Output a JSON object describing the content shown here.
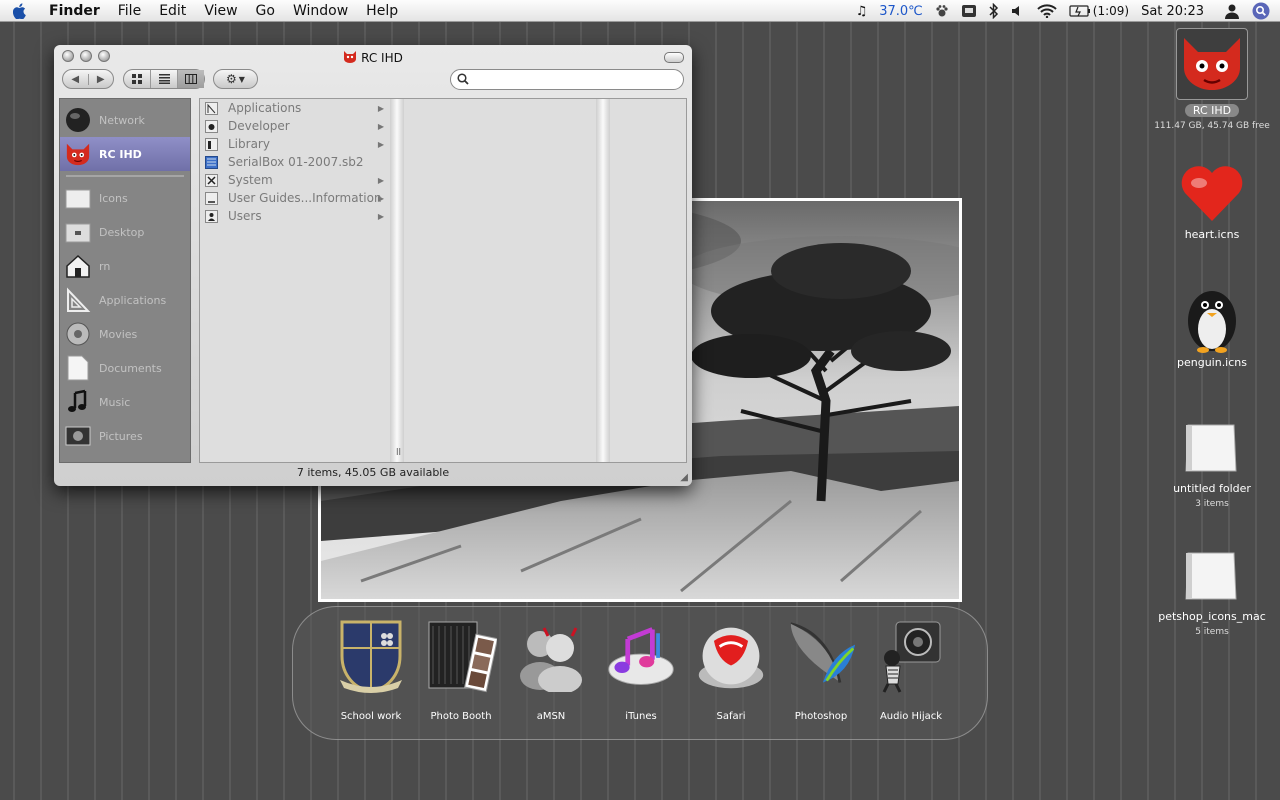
{
  "menubar": {
    "apple_icon": "apple-icon",
    "items": [
      "Finder",
      "File",
      "Edit",
      "View",
      "Go",
      "Window",
      "Help"
    ],
    "temperature": "37.0℃",
    "battery_time": "(1:09)",
    "clock": "Sat 20:23"
  },
  "window": {
    "title": "RC IHD",
    "search_placeholder": "",
    "sidebar": [
      {
        "label": "Network",
        "icon": "network-icon"
      },
      {
        "label": "RC IHD",
        "icon": "devil-cat-icon",
        "selected": true
      },
      {
        "label": "Icons",
        "icon": "folder-icon"
      },
      {
        "label": "Desktop",
        "icon": "desktop-icon"
      },
      {
        "label": "rn",
        "icon": "home-icon"
      },
      {
        "label": "Applications",
        "icon": "applications-icon"
      },
      {
        "label": "Movies",
        "icon": "movies-icon"
      },
      {
        "label": "Documents",
        "icon": "documents-icon"
      },
      {
        "label": "Music",
        "icon": "music-icon"
      },
      {
        "label": "Pictures",
        "icon": "pictures-icon"
      }
    ],
    "files": [
      {
        "name": "Applications",
        "folder": true
      },
      {
        "name": "Developer",
        "folder": true
      },
      {
        "name": "Library",
        "folder": true
      },
      {
        "name": "SerialBox 01-2007.sb2",
        "folder": false
      },
      {
        "name": "System",
        "folder": true
      },
      {
        "name": "User Guides...Information",
        "folder": true
      },
      {
        "name": "Users",
        "folder": true
      }
    ],
    "status": "7 items, 45.05 GB available"
  },
  "dock": [
    {
      "label": "School work",
      "icon": "school-crest-icon"
    },
    {
      "label": "Photo Booth",
      "icon": "photo-booth-icon"
    },
    {
      "label": "aMSN",
      "icon": "amsn-icon"
    },
    {
      "label": "iTunes",
      "icon": "itunes-icon"
    },
    {
      "label": "Safari",
      "icon": "safari-icon"
    },
    {
      "label": "Photoshop",
      "icon": "photoshop-icon"
    },
    {
      "label": "Audio Hijack",
      "icon": "audio-hijack-icon"
    }
  ],
  "desktop": {
    "drive": {
      "label": "RC IHD",
      "info": "111.47 GB, 45.74 GB free"
    },
    "heart": {
      "label": "heart.icns"
    },
    "penguin": {
      "label": "penguin.icns"
    },
    "folder1": {
      "label": "untitled folder",
      "info": "3 items"
    },
    "folder2": {
      "label": "petshop_icons_mac",
      "info": "5 items"
    }
  },
  "colors": {
    "menubar_temp": "#1d57c9",
    "sidebar_selection": "#7e7eb8",
    "desktop_stripe": "#5a5a5a"
  }
}
